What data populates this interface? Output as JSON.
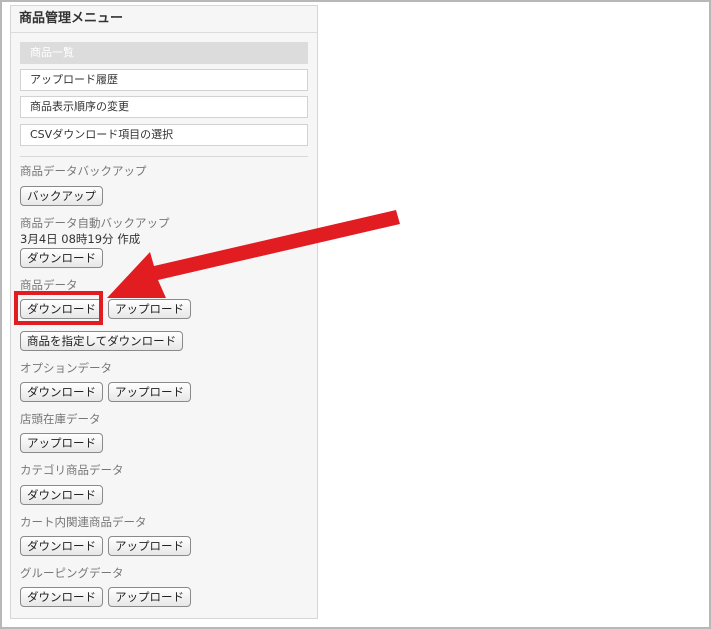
{
  "title": "商品管理メニュー",
  "menu": [
    {
      "label": "商品一覧",
      "active": true
    },
    {
      "label": "アップロード履歴",
      "active": false
    },
    {
      "label": "商品表示順序の変更",
      "active": false
    },
    {
      "label": "CSVダウンロード項目の選択",
      "active": false
    }
  ],
  "backup": {
    "label": "商品データバックアップ",
    "button": "バックアップ"
  },
  "auto_backup": {
    "label": "商品データ自動バックアップ",
    "timestamp": "3月4日 08時19分 作成",
    "download": "ダウンロード"
  },
  "product_data": {
    "label": "商品データ",
    "download": "ダウンロード",
    "upload": "アップロード",
    "download_specified": "商品を指定してダウンロード"
  },
  "option_data": {
    "label": "オプションデータ",
    "download": "ダウンロード",
    "upload": "アップロード"
  },
  "store_stock": {
    "label": "店頭在庫データ",
    "upload": "アップロード"
  },
  "category_data": {
    "label": "カテゴリ商品データ",
    "download": "ダウンロード"
  },
  "cart_related": {
    "label": "カート内関連商品データ",
    "download": "ダウンロード",
    "upload": "アップロード"
  },
  "grouping": {
    "label": "グルーピングデータ",
    "download": "ダウンロード",
    "upload": "アップロード"
  },
  "colors": {
    "annotation": "#e11d22",
    "active_menu_bg": "#dcdcdc"
  }
}
